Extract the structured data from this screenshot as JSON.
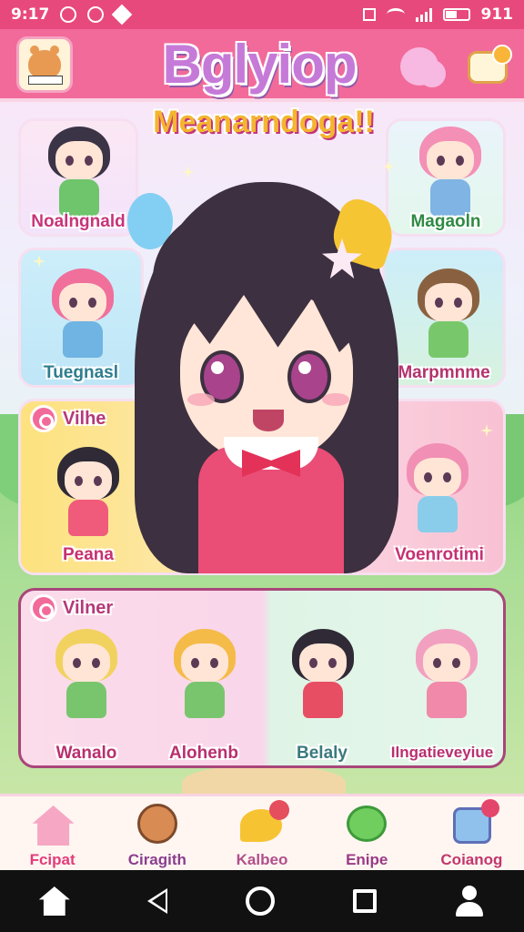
{
  "status_bar": {
    "time": "9:17",
    "battery": "911"
  },
  "header": {
    "app_title": "Bglyiop",
    "subtitle": "Meanarndoga!!"
  },
  "cards": {
    "top_left": {
      "name": "Noalngnald"
    },
    "top_right": {
      "name": "Magaoln"
    },
    "mid_left": {
      "name": "Tuegnasl"
    },
    "mid_right": {
      "name": "Marpmnme"
    }
  },
  "section_yellow": {
    "pill": "Vilhe",
    "left_name": "Peana",
    "right_name": "Voenrotimi"
  },
  "section_pink": {
    "pill": "Vilner",
    "characters": [
      {
        "name": "Wanalo"
      },
      {
        "name": "Alohenb"
      },
      {
        "name": "Belaly"
      },
      {
        "name": "Ilngatieveyiue"
      }
    ]
  },
  "bottom_nav": [
    {
      "label": "Fcipat",
      "icon": "home-icon",
      "color": "#e33b7a"
    },
    {
      "label": "Ciragith",
      "icon": "coin-icon",
      "color": "#8a3e8f"
    },
    {
      "label": "Kalbeo",
      "icon": "chat-icon",
      "color": "#b24f8a"
    },
    {
      "label": "Enipe",
      "icon": "bubble-icon",
      "color": "#9a3a85"
    },
    {
      "label": "Coianog",
      "icon": "frame-icon",
      "color": "#c2366c"
    }
  ],
  "colors": {
    "accent": "#f26a9a",
    "status_bar": "#e8497c"
  }
}
